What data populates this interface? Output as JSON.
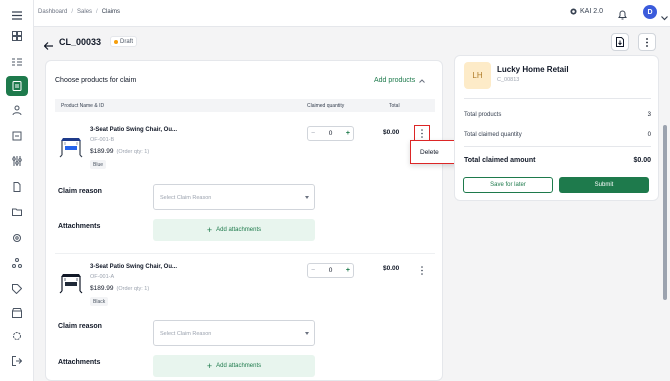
{
  "breadcrumb": {
    "items": [
      "Dashboard",
      "Sales",
      "Claims"
    ],
    "separator": "/"
  },
  "header": {
    "kai_label": "KAI 2.0",
    "avatar_initial": "D"
  },
  "page": {
    "claim_id": "CL_00033",
    "status": "Draft"
  },
  "products_card": {
    "title": "Choose products for claim",
    "add_products_label": "Add products",
    "columns": {
      "name": "Product Name & ID",
      "claimed_qty": "Claimed quantity",
      "total": "Total"
    },
    "items": [
      {
        "name": "3-Seat Patio Swing Chair, Ou...",
        "sku": "OF-001-B",
        "price": "$189.99",
        "order_qty": "(Order qty: 1)",
        "variant": "Blue",
        "claimed_qty": "0",
        "total": "$0.00",
        "claim_reason_label": "Claim reason",
        "claim_reason_placeholder": "Select Claim Reason",
        "attachments_label": "Attachments",
        "add_attachments_label": "Add attachments"
      },
      {
        "name": "3-Seat Patio Swing Chair, Ou...",
        "sku": "OF-001-A",
        "price": "$189.99",
        "order_qty": "(Order qty: 1)",
        "variant": "Black",
        "claimed_qty": "0",
        "total": "$0.00",
        "claim_reason_label": "Claim reason",
        "claim_reason_placeholder": "Select Claim Reason",
        "attachments_label": "Attachments",
        "add_attachments_label": "Add attachments"
      }
    ],
    "row_menu": {
      "delete_label": "Delete"
    }
  },
  "summary": {
    "initials": "LH",
    "customer_name": "Lucky Home Retail",
    "customer_code": "C_00813",
    "total_products_label": "Total products",
    "total_products_value": "3",
    "total_claimed_qty_label": "Total claimed quantity",
    "total_claimed_qty_value": "0",
    "total_claimed_amount_label": "Total claimed amount",
    "total_claimed_amount_value": "$0.00",
    "save_later_label": "Save for later",
    "submit_label": "Submit"
  },
  "colors": {
    "brand": "#1e7a4c",
    "highlight": "#dc2626",
    "draft_dot": "#f59e0b"
  }
}
